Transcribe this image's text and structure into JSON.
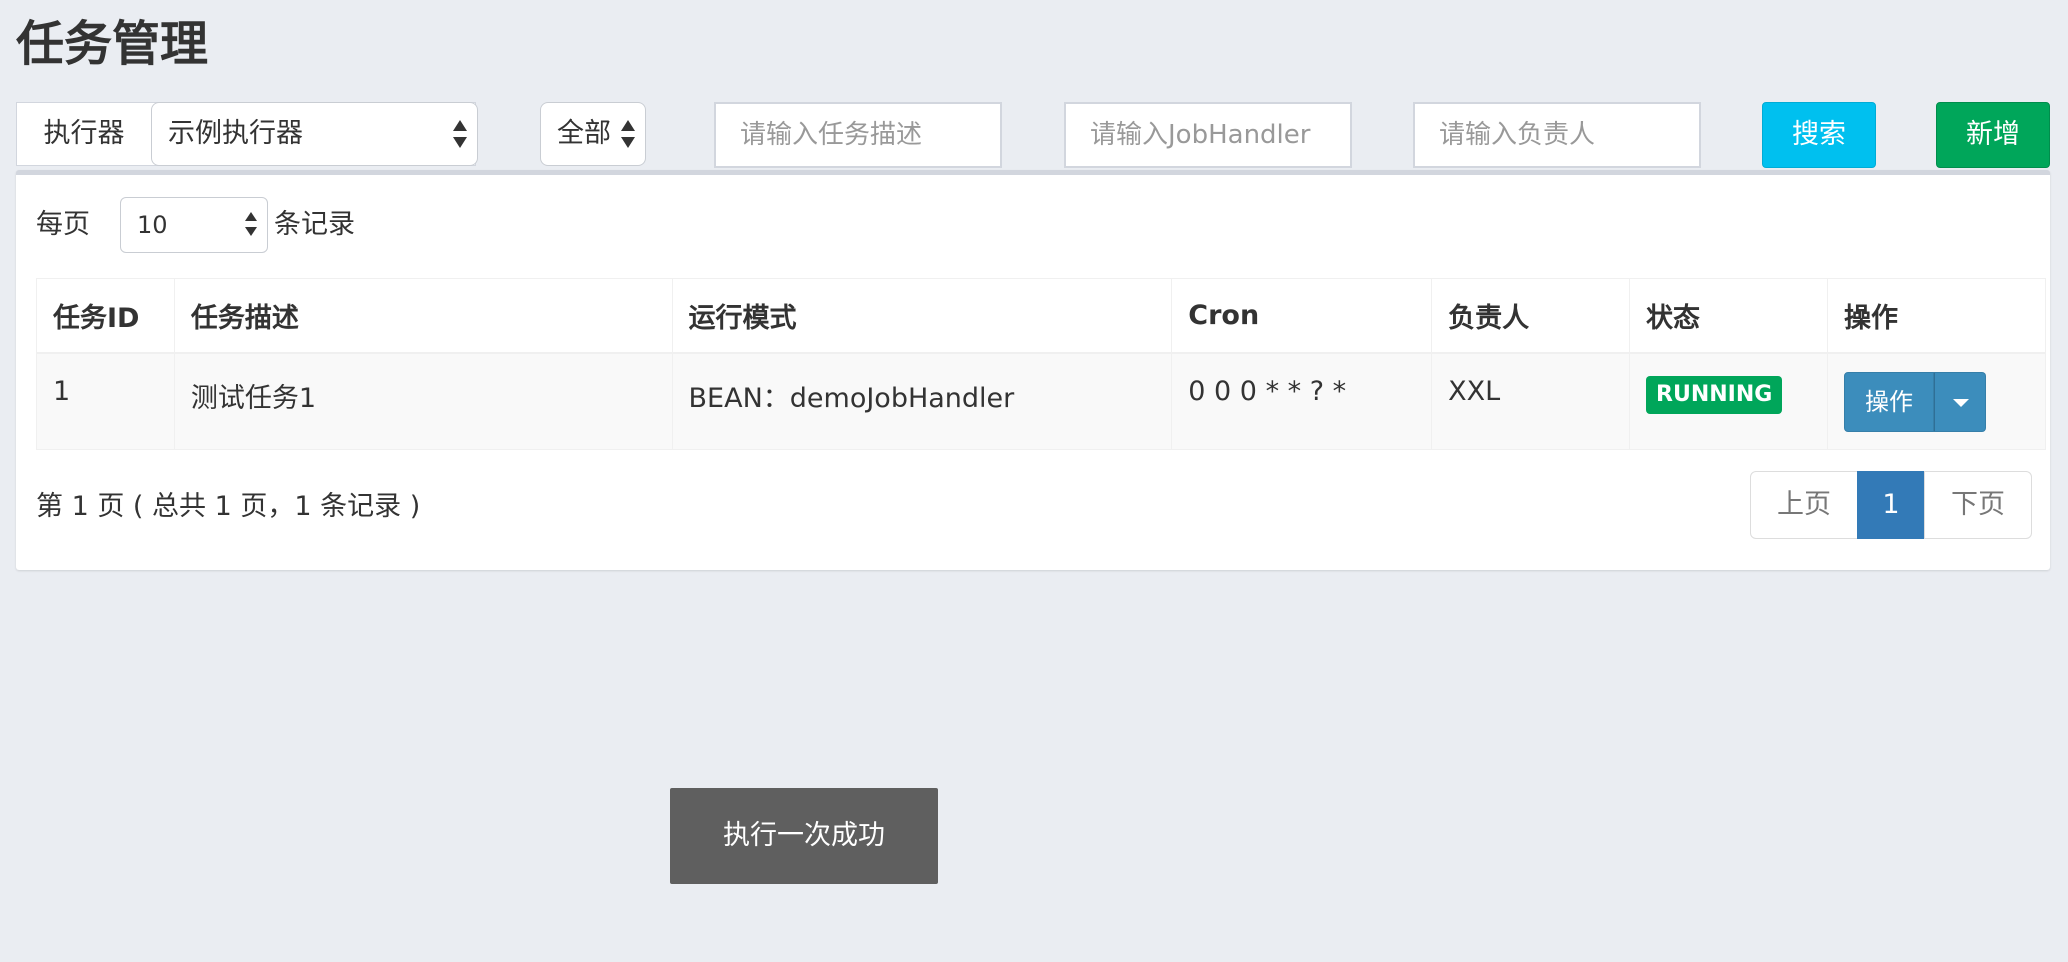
{
  "page": {
    "title": "任务管理"
  },
  "filters": {
    "executor_label": "执行器",
    "executor_value": "示例执行器",
    "status_value": "全部",
    "job_desc_placeholder": "请输入任务描述",
    "job_handler_placeholder": "请输入JobHandler",
    "author_placeholder": "请输入负责人",
    "search_label": "搜索",
    "add_label": "新增"
  },
  "table_controls": {
    "per_page_prefix": "每页",
    "per_page_value": "10",
    "per_page_suffix": "条记录"
  },
  "table": {
    "columns": [
      "任务ID",
      "任务描述",
      "运行模式",
      "Cron",
      "负责人",
      "状态",
      "操作"
    ],
    "rows": [
      {
        "id": "1",
        "desc": "测试任务1",
        "mode": "BEAN：demoJobHandler",
        "cron": "0 0 0 * * ? *",
        "author": "XXL",
        "status": "RUNNING",
        "action_label": "操作"
      }
    ]
  },
  "pagination": {
    "info": "第 1 页 ( 总共 1 页，1 条记录 )",
    "prev": "上页",
    "current": "1",
    "next": "下页"
  },
  "toast": {
    "message": "执行一次成功"
  },
  "colors": {
    "background": "#eaedf2",
    "search_button": "#00c0ef",
    "add_button": "#00a65a",
    "running_badge": "#00a65a",
    "action_button": "#3c8dbc",
    "active_page": "#337ab7",
    "toast": "#5f5f5f"
  }
}
